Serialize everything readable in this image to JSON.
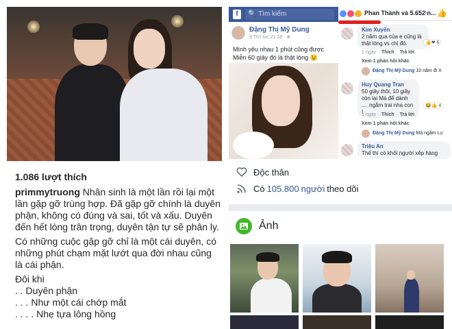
{
  "instagram": {
    "likes": "1.086 lượt thích",
    "username": "primmytruong",
    "caption_lines": [
      " Nhân sinh là một lần rồi lại một lần gặp gỡ trùng hợp. Đã gặp gỡ chính là duyên phận, không có đúng và sai, tốt và xấu. Duyên đến hết lòng trân trọng, duyên tận tự sẽ phân ly.",
      "Có những cuộc gặp gỡ chỉ là một cái duyên, có những phút chạm mặt lướt qua đời nhau cũng là cái phận.",
      "Đôi khi",
      ". . Duyên phận",
      ". . . Như một cái chớp mắt",
      ". . . . Nhẹ tựa lông hồng"
    ]
  },
  "fb_post": {
    "search_placeholder": "Tìm kiếm",
    "author": "Đặng Thị Mỹ Dung",
    "time": "9 Th1 lúc 21:28 · ⊕",
    "text_line1": "Mình yêu nhau 1 phút cũng được",
    "text_line2": "Miễn 60 giây đó là thật lòng 😉"
  },
  "fb_comments": {
    "reaction_names": "Phan Thành và 5.652 n...",
    "comments": [
      {
        "author": "Kim Xuyến",
        "text": "2 năm qua của e cũng là thật lòng vs chị đó.",
        "meta": "1 ngày",
        "like": "Thích",
        "reply": "Trả lời",
        "count": "6"
      },
      {
        "more": "Xem 1 phản hồi khác"
      },
      {
        "reply_author": "Đặng Thị Mỹ Dung",
        "reply_text": "10 năm đi X"
      },
      {
        "author": "Huy Quang Tran",
        "text": "50 giây thôi, 10 giây còn lại Má để dành .... ngắm trai nha con !",
        "meta": "1 ngày",
        "like": "Thích",
        "reply": "Trả lời",
        "count": "4"
      },
      {
        "more": "Xem 1 phản hồi khác"
      },
      {
        "reply_author": "Đặng Thị Mỹ Dung",
        "reply_text": "Má ngắm Lu"
      },
      {
        "author": "Triệu An",
        "text": "Thế thì có khối người xếp hàng"
      }
    ]
  },
  "fb_intro": {
    "relationship": "Độc thân",
    "followers_prefix": "Có",
    "followers_count": "105.800",
    "followers_unit": "người",
    "followers_suffix": "theo dõi",
    "photos_title": "Ảnh"
  },
  "colors": {
    "fb_blue": "#3b5998",
    "fb_link": "#365899",
    "photos_green": "#42b72a",
    "highlight_red": "#e02020"
  }
}
